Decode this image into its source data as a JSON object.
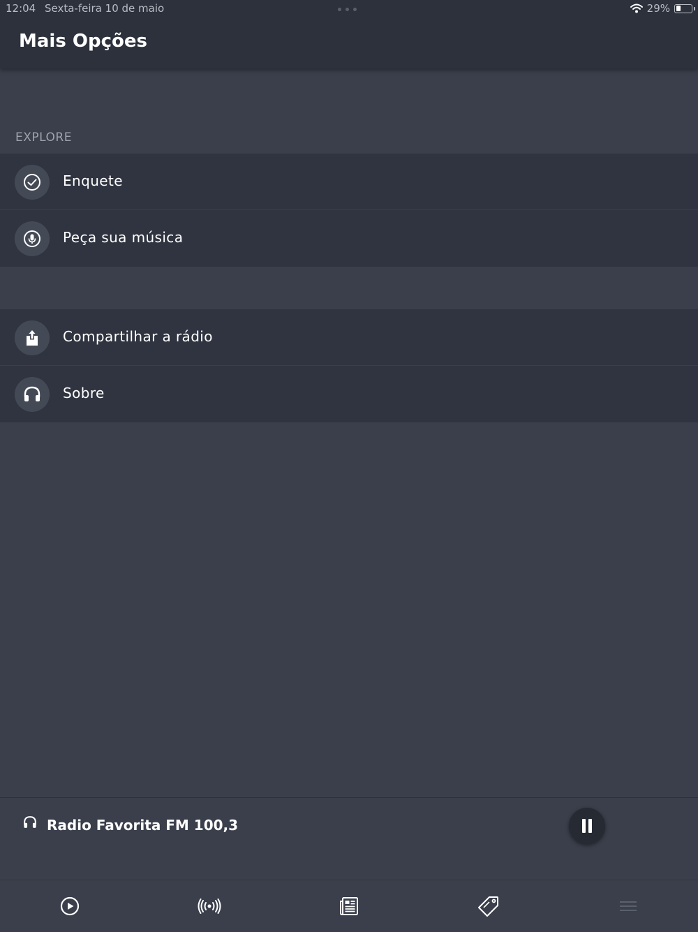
{
  "status_bar": {
    "time": "12:04",
    "date": "Sexta-feira 10 de maio",
    "battery_percent": "29%",
    "battery_level": 0.29
  },
  "header": {
    "title": "Mais Opções"
  },
  "sections": [
    {
      "label": "EXPLORE",
      "items": [
        {
          "label": "Enquete",
          "icon": "check-circle-icon"
        },
        {
          "label": "Peça sua música",
          "icon": "microphone-icon"
        }
      ]
    },
    {
      "label": "",
      "items": [
        {
          "label": "Compartilhar a rádio",
          "icon": "share-icon"
        },
        {
          "label": "Sobre",
          "icon": "headphones-icon"
        }
      ]
    }
  ],
  "player": {
    "station": "Radio Favorita FM 100,3",
    "icon": "headphones-icon",
    "state": "playing",
    "control_icon": "pause-icon"
  },
  "tab_bar": {
    "tabs": [
      {
        "icon": "play-circle-icon",
        "active": false
      },
      {
        "icon": "broadcast-icon",
        "active": false
      },
      {
        "icon": "news-icon",
        "active": false
      },
      {
        "icon": "tag-icon",
        "active": false
      },
      {
        "icon": "menu-icon",
        "active": true
      }
    ]
  },
  "colors": {
    "background": "#3a3f4b",
    "header": "#2c313c",
    "row": "#2f3440",
    "icon_circle": "#444a55",
    "section_label": "#9ea3ad"
  }
}
